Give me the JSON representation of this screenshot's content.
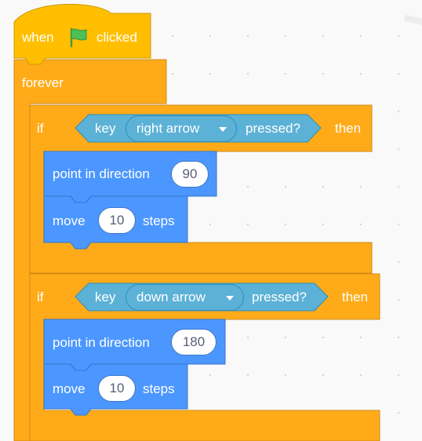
{
  "script": {
    "hat": {
      "before": "when",
      "after": "clicked",
      "icon": "green-flag-icon"
    },
    "forever_label": "forever",
    "if_blocks": [
      {
        "if_label": "if",
        "condition": {
          "key_label": "key",
          "key_value": "right arrow",
          "pressed_label": "pressed?"
        },
        "then_label": "then",
        "actions": {
          "point": {
            "label": "point in direction",
            "value": "90"
          },
          "move": {
            "label": "move",
            "value": "10",
            "suffix": "steps"
          }
        }
      },
      {
        "if_label": "if",
        "condition": {
          "key_label": "key",
          "key_value": "down arrow",
          "pressed_label": "pressed?"
        },
        "then_label": "then",
        "actions": {
          "point": {
            "label": "point in direction",
            "value": "180"
          },
          "move": {
            "label": "move",
            "value": "10",
            "suffix": "steps"
          }
        }
      }
    ]
  },
  "colors": {
    "events": "#ffbf00",
    "control": "#ffab19",
    "motion": "#4c97ff",
    "sensing": "#5cb1d6",
    "flag": "#4cbf56"
  }
}
